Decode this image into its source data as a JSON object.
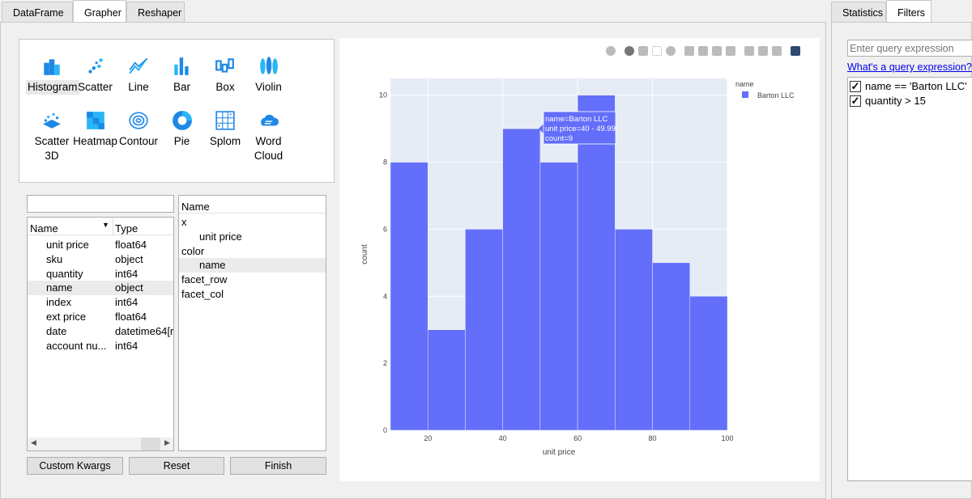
{
  "left_tabs": [
    "DataFrame",
    "Grapher",
    "Reshaper"
  ],
  "left_active": "Grapher",
  "right_tabs": [
    "Statistics",
    "Filters"
  ],
  "right_active": "Filters",
  "plot_types": [
    {
      "label": "Histogram",
      "icon": "histogram-icon",
      "selected": true
    },
    {
      "label": "Scatter",
      "icon": "scatter-icon"
    },
    {
      "label": "Line",
      "icon": "line-icon"
    },
    {
      "label": "Bar",
      "icon": "bar-icon"
    },
    {
      "label": "Box",
      "icon": "box-icon"
    },
    {
      "label": "Violin",
      "icon": "violin-icon"
    },
    {
      "label": "Scatter\n3D",
      "icon": "scatter3d-icon"
    },
    {
      "label": "Heatmap",
      "icon": "heatmap-icon"
    },
    {
      "label": "Contour",
      "icon": "contour-icon"
    },
    {
      "label": "Pie",
      "icon": "pie-icon"
    },
    {
      "label": "Splom",
      "icon": "splom-icon"
    },
    {
      "label": "Word\nCloud",
      "icon": "wordcloud-icon"
    }
  ],
  "columns": {
    "search_value": "",
    "headers": [
      "Name",
      "Type"
    ],
    "rows": [
      [
        "unit price",
        "float64"
      ],
      [
        "sku",
        "object"
      ],
      [
        "quantity",
        "int64"
      ],
      [
        "name",
        "object"
      ],
      [
        "index",
        "int64"
      ],
      [
        "ext price",
        "float64"
      ],
      [
        "date",
        "datetime64[r"
      ],
      [
        "account nu...",
        "int64"
      ]
    ],
    "selected_row": 3
  },
  "mapping": {
    "header": "Name",
    "items": [
      {
        "label": "x",
        "level": 0
      },
      {
        "label": "unit price",
        "level": 1
      },
      {
        "label": "color",
        "level": 0
      },
      {
        "label": "name",
        "level": 1,
        "selected": true
      },
      {
        "label": "facet_row",
        "level": 0
      },
      {
        "label": "facet_col",
        "level": 0
      }
    ]
  },
  "buttons": {
    "custom_kwargs": "Custom Kwargs",
    "reset": "Reset",
    "finish": "Finish"
  },
  "filters": {
    "placeholder": "Enter query expression",
    "help_link": "What's a query expression?",
    "items": [
      {
        "label": "name == 'Barton LLC'",
        "checked": true
      },
      {
        "label": "quantity > 15",
        "checked": true
      }
    ]
  },
  "chart_data": {
    "type": "bar",
    "subtype": "histogram",
    "xlabel": "unit price",
    "ylabel": "count",
    "xlim": [
      10,
      100
    ],
    "ylim": [
      0,
      10.5
    ],
    "xticks": [
      20,
      40,
      60,
      80,
      100
    ],
    "yticks": [
      0,
      2,
      4,
      6,
      8,
      10
    ],
    "grid": true,
    "bin_edges": [
      10,
      20,
      30,
      40,
      50,
      60,
      70,
      80,
      90,
      100
    ],
    "series": [
      {
        "name": "Barton LLC",
        "values": [
          8,
          3,
          6,
          9,
          8,
          10,
          6,
          5,
          4
        ],
        "color": "#636efa"
      }
    ],
    "legend": {
      "title": "name",
      "placement": "top-right"
    },
    "tooltip": {
      "lines": [
        "name=Barton LLC",
        "unit price=40 - 49.99",
        "count=9"
      ]
    },
    "background": "#e5ecf6"
  },
  "modebar_icons": [
    "camera-icon",
    "zoom-icon",
    "pan-icon",
    "box-select-icon",
    "lasso-icon",
    "zoom-in-icon",
    "zoom-out-icon",
    "autoscale-icon",
    "home-icon",
    "spikelines-icon",
    "hover-closest-icon",
    "hover-compare-icon",
    "plotly-logo-icon"
  ]
}
